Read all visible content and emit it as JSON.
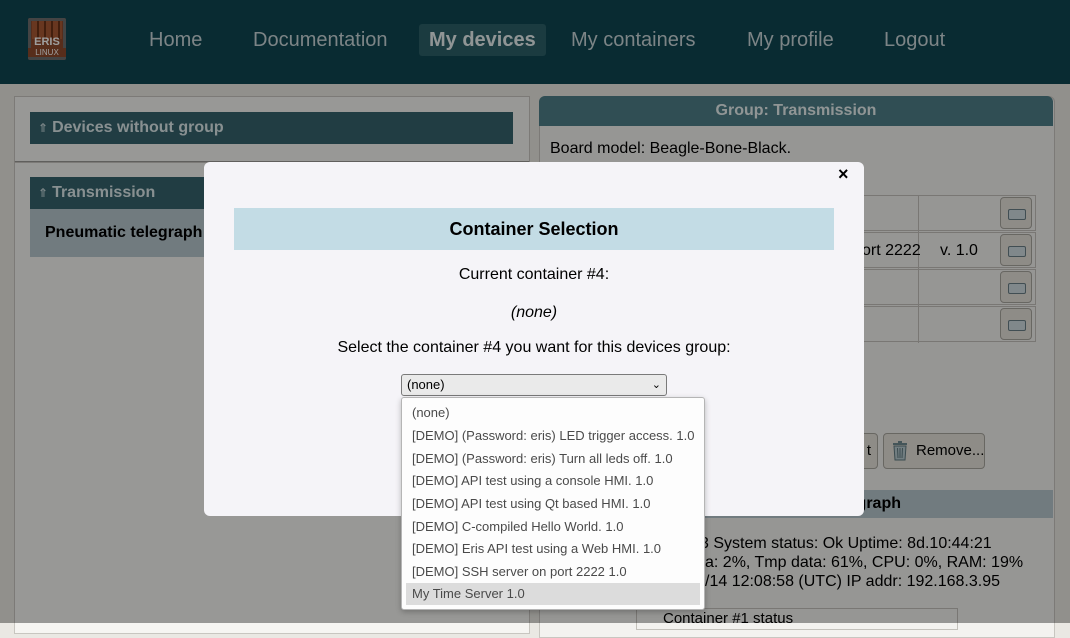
{
  "nav": {
    "logo_top": "ERIS",
    "logo_bottom": "LINUX",
    "items": [
      "Home",
      "Documentation",
      "My devices",
      "My containers",
      "My profile",
      "Logout"
    ],
    "active": "My devices"
  },
  "left": {
    "groups": [
      {
        "name": "Devices without group"
      },
      {
        "name": "Transmission"
      }
    ],
    "arrow": "⇑",
    "device": "Pneumatic telegraph"
  },
  "right": {
    "title": "Group: Transmission",
    "board_model": "Board model: Beagle-Bone-Black.",
    "container_port": "ort 2222",
    "container_version": "v. 1.0",
    "restart_label": "t",
    "remove_label": "Remove...",
    "graph_title": "graph",
    "status_line1": "3     System status: Ok    Uptime: 8d.10:44:21",
    "status_line2": "a: 2%, Tmp data: 61%, CPU: 0%, RAM: 19%",
    "status_line3": "/14 12:08:58 (UTC)    IP addr: 192.168.3.95",
    "container_status_header": "Container #1 status"
  },
  "modal": {
    "close": "×",
    "title": "Container Selection",
    "current_label": "Current container #4:",
    "current_value": "(none)",
    "prompt": "Select the container #4 you want for this devices group:",
    "select_value": "(none)",
    "options": [
      "(none)",
      "[DEMO] (Password: eris) LED trigger access. 1.0",
      "[DEMO] (Password: eris) Turn all leds off. 1.0",
      "[DEMO] API test using a console HMI. 1.0",
      "[DEMO] API test using Qt based HMI. 1.0",
      "[DEMO] C-compiled Hello World. 1.0",
      "[DEMO] Eris API test using a Web HMI. 1.0",
      "[DEMO] SSH server on port 2222 1.0",
      "My Time Server 1.0"
    ],
    "highlighted_option": "My Time Server 1.0"
  }
}
